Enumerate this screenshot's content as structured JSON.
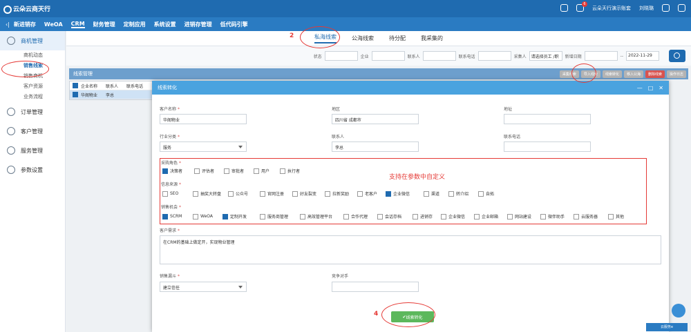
{
  "topbar": {
    "logo": "云朵云商天行",
    "user": "云朵天行演示账套",
    "badge": "6",
    "admin": "刘晓璐"
  },
  "nav": {
    "items": [
      "新进销存",
      "WeOA",
      "CRM",
      "财务管理",
      "定制应用",
      "系统设置",
      "进销存管理",
      "低代码引擎"
    ]
  },
  "sidebar": {
    "groups": [
      {
        "label": "商机管理",
        "subs": [
          "商机动态",
          "销售线索",
          "销售商机",
          "客户资源",
          "业务流程"
        ]
      },
      {
        "label": "订单管理"
      },
      {
        "label": "客户管理"
      },
      {
        "label": "服务管理"
      },
      {
        "label": "参数设置"
      }
    ]
  },
  "tabs": [
    "私海线索",
    "公海线索",
    "待分配",
    "我采集的"
  ],
  "filters": {
    "status": "状态",
    "company": "企业",
    "contact": "联系人",
    "phone": "联系电话",
    "collector": "采集人",
    "collector_value": "请选择员工 /职",
    "date": "新增日期",
    "date_to": "2022-11-29"
  },
  "listbar": {
    "title": "线索管理",
    "buttons": [
      "采集线索",
      "导入线索",
      "线索转化",
      "移入公海",
      "删除线索",
      "操作日志"
    ]
  },
  "grid": {
    "headers": [
      "企业名称",
      "联系人",
      "联系电话"
    ],
    "rows": [
      [
        "华阁物业",
        "李总"
      ]
    ]
  },
  "modal": {
    "title": "线索转化",
    "fields": {
      "customer_name_label": "客户名称",
      "customer_name": "华阁物业",
      "region_label": "地区",
      "region": "四川省 成都市",
      "address_label": "地址",
      "industry_label": "行业分类",
      "industry": "服务",
      "contact_label": "联系人",
      "contact": "李总",
      "phone_label": "联系电话",
      "purchase_role_label": "采购角色",
      "purchase_roles": [
        "决策者",
        "评估者",
        "审批者",
        "用户",
        "执行者"
      ],
      "source_label": "信息来源",
      "sources": [
        "SEO",
        "抽奖大转盘",
        "公众号",
        "官网注册",
        "好友裂变",
        "拉新奖励",
        "老客户",
        "企业微信",
        "渠道",
        "转介绍",
        "自拓"
      ],
      "opportunity_label": "销售机会",
      "opportunities": [
        "SCRM",
        "WeOA",
        "定制开发",
        "服务商管理",
        "高效管理平台",
        "合作代理",
        "会话存档",
        "进销存",
        "企业微信",
        "企业邮箱",
        "网站建设",
        "微伴助手",
        "云服务器",
        "其他"
      ],
      "note": "支持在参数中自定义",
      "demand_label": "客户需求",
      "demand": "在CRM的基础上做定开，实现物业管理",
      "funnel_label": "销售漏斗",
      "funnel": "建立信任",
      "competitor_label": "竞争对手",
      "convert_button": "线索转化"
    }
  },
  "annotations": [
    "2",
    "4"
  ],
  "statusbar": "云服务e"
}
